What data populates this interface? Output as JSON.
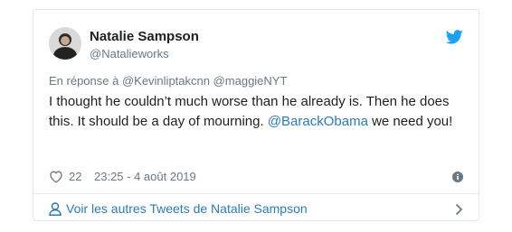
{
  "author": {
    "display_name": "Natalie Sampson",
    "handle": "@Natalieworks",
    "avatar_icon": "avatar-photo"
  },
  "reply_context": "En réponse à @Kevinliptakcnn @maggieNYT",
  "tweet": {
    "text_part1": "I thought he couldn’t much worse than he already is. Then he does this. It should be a day of mourning. ",
    "mention": "@BarackObama",
    "text_part2": " we need you!"
  },
  "meta": {
    "like_count": "22",
    "timestamp": "23:25 - 4 août 2019",
    "heart_icon": "heart-outline-icon",
    "info_icon": "info-icon"
  },
  "footer": {
    "more_tweets_label": "Voir les autres Tweets de Natalie Sampson",
    "person_icon": "person-icon",
    "chevron_icon": "chevron-right-icon"
  },
  "colors": {
    "link": "#2b7bb9",
    "secondary_text": "#697882",
    "border": "#e1e8ed",
    "twitter_blue": "#1da1f2"
  }
}
